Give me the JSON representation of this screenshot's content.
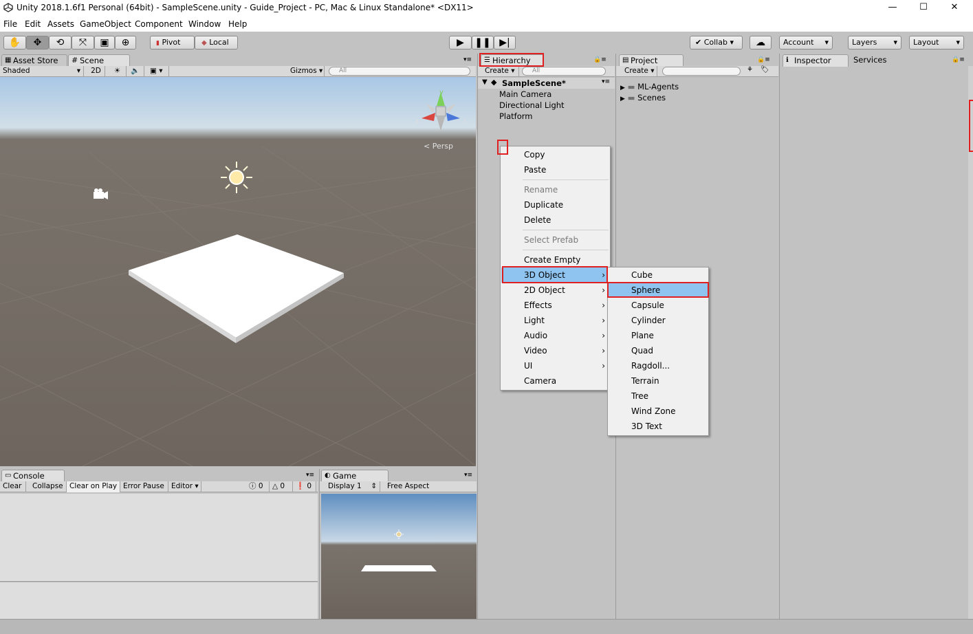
{
  "window": {
    "title": "Unity 2018.1.6f1 Personal (64bit) - SampleScene.unity - Guide_Project - PC, Mac & Linux Standalone* <DX11>",
    "minimize": "—",
    "maximize": "☐",
    "close": "✕"
  },
  "menubar": [
    "File",
    "Edit",
    "Assets",
    "GameObject",
    "Component",
    "Window",
    "Help"
  ],
  "toolbar": {
    "pivot": "Pivot",
    "local": "Local",
    "collab": "Collab ▾",
    "account": "Account",
    "layers": "Layers",
    "layout": "Layout"
  },
  "scene_panel": {
    "tab_asset_store": "Asset Store",
    "tab_scene": "Scene",
    "shading": "Shaded",
    "mode_2d": "2D",
    "gizmos": "Gizmos",
    "search_placeholder": "All",
    "persp": "Persp",
    "gizmo_y": "y",
    "gizmo_x": "x",
    "gizmo_z": "z"
  },
  "hierarchy": {
    "tab": "Hierarchy",
    "create": "Create",
    "search_placeholder": "All",
    "scene_name": "SampleScene*",
    "items": [
      "Main Camera",
      "Directional Light",
      "Platform"
    ]
  },
  "project": {
    "tab": "Project",
    "create": "Create",
    "folders": [
      "ML-Agents",
      "Scenes"
    ]
  },
  "inspector": {
    "tab": "Inspector",
    "tab_services": "Services"
  },
  "console": {
    "tab": "Console",
    "buttons": [
      "Clear",
      "Collapse",
      "Clear on Play",
      "Error Pause",
      "Editor"
    ],
    "count_info": "0",
    "count_warn": "0",
    "count_error": "0"
  },
  "game": {
    "tab": "Game",
    "display": "Display 1",
    "aspect": "Free Aspect"
  },
  "context_menu": {
    "items": [
      {
        "label": "Copy",
        "disabled": false
      },
      {
        "label": "Paste",
        "disabled": false
      },
      {
        "label": "Rename",
        "disabled": true
      },
      {
        "label": "Duplicate",
        "disabled": false
      },
      {
        "label": "Delete",
        "disabled": false
      },
      {
        "label": "Select Prefab",
        "disabled": true
      },
      {
        "label": "Create Empty",
        "disabled": false
      },
      {
        "label": "3D Object",
        "disabled": false
      },
      {
        "label": "2D Object",
        "disabled": false
      },
      {
        "label": "Effects",
        "disabled": false
      },
      {
        "label": "Light",
        "disabled": false
      },
      {
        "label": "Audio",
        "disabled": false
      },
      {
        "label": "Video",
        "disabled": false
      },
      {
        "label": "UI",
        "disabled": false
      },
      {
        "label": "Camera",
        "disabled": false
      }
    ],
    "submenu": [
      "Cube",
      "Sphere",
      "Capsule",
      "Cylinder",
      "Plane",
      "Quad",
      "Ragdoll...",
      "Terrain",
      "Tree",
      "Wind Zone",
      "3D Text"
    ]
  },
  "colors": {
    "highlight": "#8fc4f0",
    "annotation_red": "#e02020",
    "panel_bg": "#c2c2c2"
  }
}
